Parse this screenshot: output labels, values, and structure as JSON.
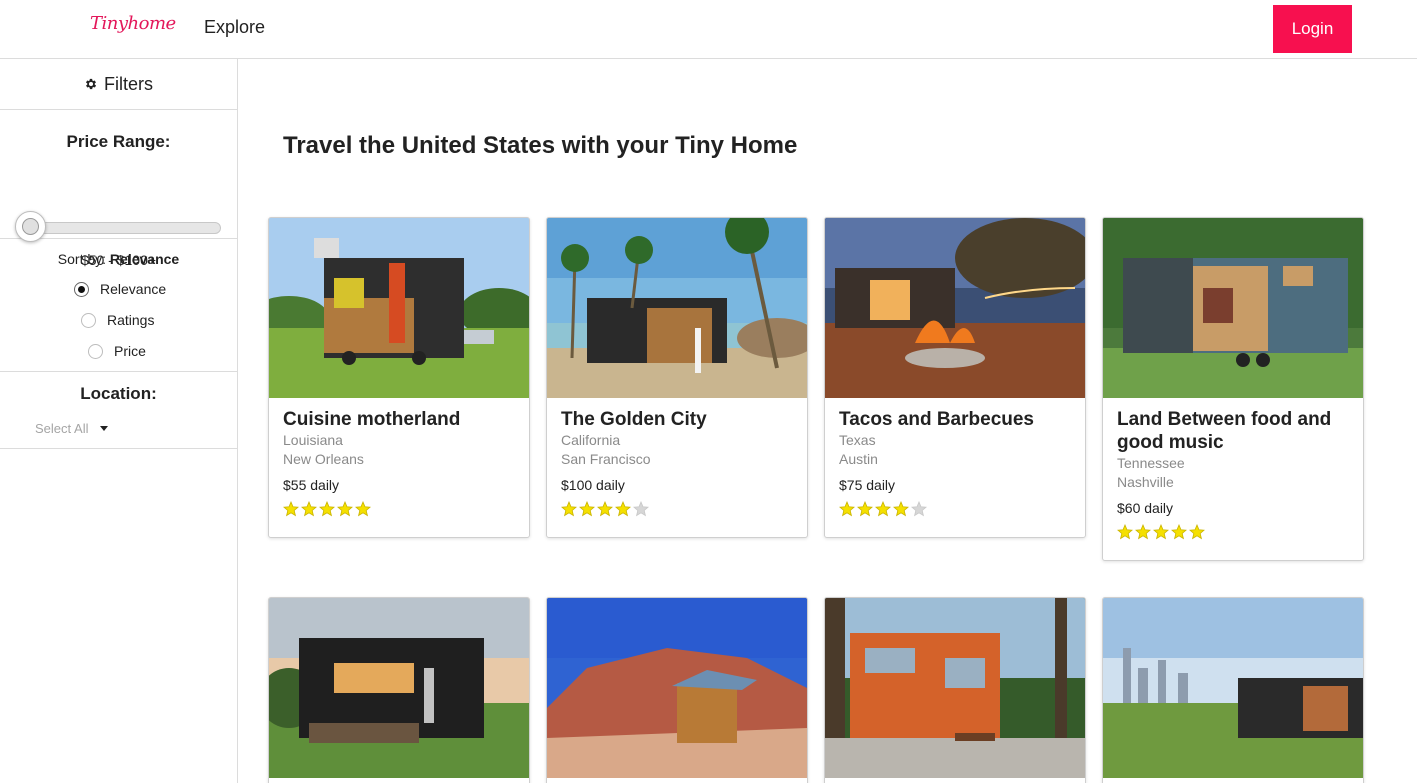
{
  "header": {
    "logo": "Tinyhome",
    "nav_explore": "Explore",
    "login": "Login"
  },
  "sidebar": {
    "filters_label": "Filters",
    "price_range_label": "Price Range:",
    "price_range_value": "$50 - $100+",
    "price_slider_value": 0,
    "sort_by_prefix": "Sort by:",
    "sort_by_value": "Relevance",
    "sort_options": [
      {
        "label": "Relevance",
        "checked": true
      },
      {
        "label": "Ratings",
        "checked": false
      },
      {
        "label": "Price",
        "checked": false
      }
    ],
    "location_label": "Location:",
    "location_select": "Select All"
  },
  "main": {
    "title": "Travel the United States with your Tiny Home",
    "cards": [
      {
        "title": "Cuisine motherland",
        "state": "Louisiana",
        "city": "New Orleans",
        "price": "$55 daily",
        "rating": 5
      },
      {
        "title": "The Golden City",
        "state": "California",
        "city": "San Francisco",
        "price": "$100 daily",
        "rating": 4
      },
      {
        "title": "Tacos and Barbecues",
        "state": "Texas",
        "city": "Austin",
        "price": "$75 daily",
        "rating": 4
      },
      {
        "title": "Land Between food and good music",
        "state": "Tennessee",
        "city": "Nashville",
        "price": "$60 daily",
        "rating": 5
      },
      {
        "image_only": true
      },
      {
        "image_only": true
      },
      {
        "image_only": true
      },
      {
        "image_only": true
      }
    ]
  },
  "colors": {
    "brand": "#e3175a",
    "login_bg": "#f7104f",
    "star_filled": "#f5e000",
    "star_empty": "#d6d6d6"
  }
}
